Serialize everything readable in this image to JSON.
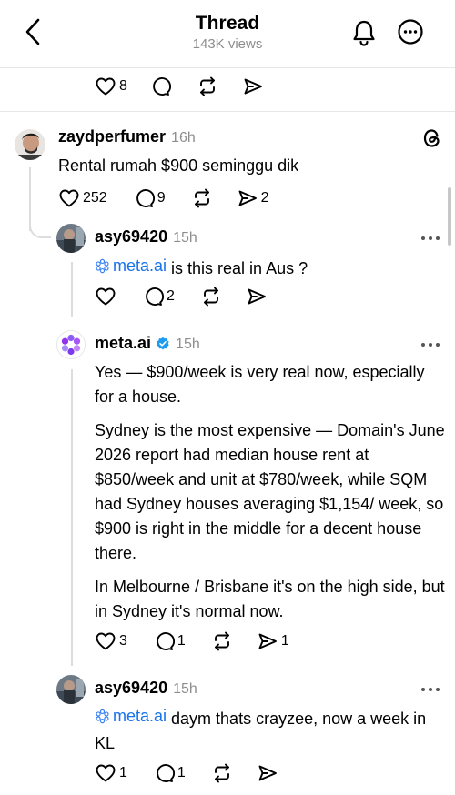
{
  "header": {
    "title": "Thread",
    "views": "143K views"
  },
  "top_actions": {
    "like_count": "8"
  },
  "post": {
    "username": "zaydperfumer",
    "time": "16h",
    "text": "Rental rumah $900 seminggu dik",
    "like_count": "252",
    "reply_count": "9",
    "share_count": "2"
  },
  "reply1": {
    "username": "asy69420",
    "time": "15h",
    "mention": "meta.ai",
    "text": " is this real in Aus ?",
    "reply_count": "2"
  },
  "reply2": {
    "username": "meta.ai",
    "time": "15h",
    "paragraphs": [
      "Yes — $900/week is very real now, especially for a house.",
      "Sydney is the most expensive — Domain's June 2026 report had median house rent at $850/week and unit at $780/week, while SQM had Sydney houses averaging $1,154/ week, so $900 is right in the middle for a decent house there.",
      "In Melbourne / Brisbane it's on the high side, but in Sydney it's normal now."
    ],
    "like_count": "3",
    "reply_count": "1",
    "share_count": "1"
  },
  "reply3": {
    "username": "asy69420",
    "time": "15h",
    "mention": "meta.ai",
    "text": " daym thats crayzee, now a week in KL",
    "like_count": "1",
    "reply_count": "1"
  },
  "colors": {
    "link": "#1a73e8",
    "verified": "#1d9bf0",
    "muted": "#8e8e8e"
  }
}
